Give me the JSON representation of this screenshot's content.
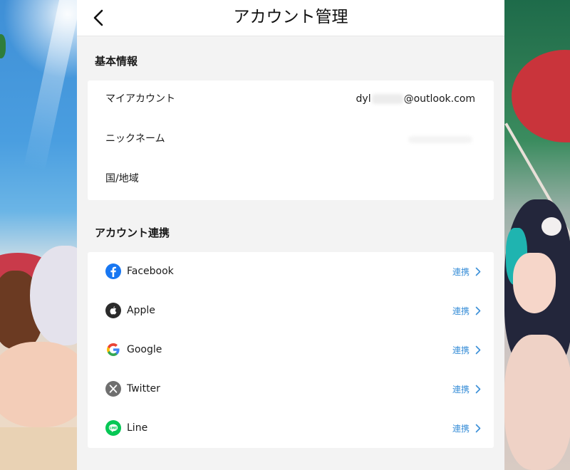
{
  "header": {
    "title": "アカウント管理",
    "back_icon": "chevron-left-icon"
  },
  "basic_info": {
    "section_title": "基本情報",
    "rows": [
      {
        "label": "マイアカウント",
        "value_prefix": "dyl",
        "value_suffix": "@outlook.com"
      },
      {
        "label": "ニックネーム"
      },
      {
        "label": "国/地域"
      }
    ]
  },
  "linking": {
    "section_title": "アカウント連携",
    "link_label": "連携",
    "items": [
      {
        "name": "Facebook",
        "icon": "facebook-icon",
        "color": "#1877F2"
      },
      {
        "name": "Apple",
        "icon": "apple-icon",
        "color": "#2b2b2b"
      },
      {
        "name": "Google",
        "icon": "google-icon",
        "color": "#4285F4"
      },
      {
        "name": "Twitter",
        "icon": "x-twitter-icon",
        "color": "#6f6f6f"
      },
      {
        "name": "Line",
        "icon": "line-icon",
        "color": "#06C755"
      }
    ]
  },
  "colors": {
    "link": "#3a8fd8",
    "panel_bg": "#f3f3f3",
    "card_bg": "#ffffff"
  }
}
